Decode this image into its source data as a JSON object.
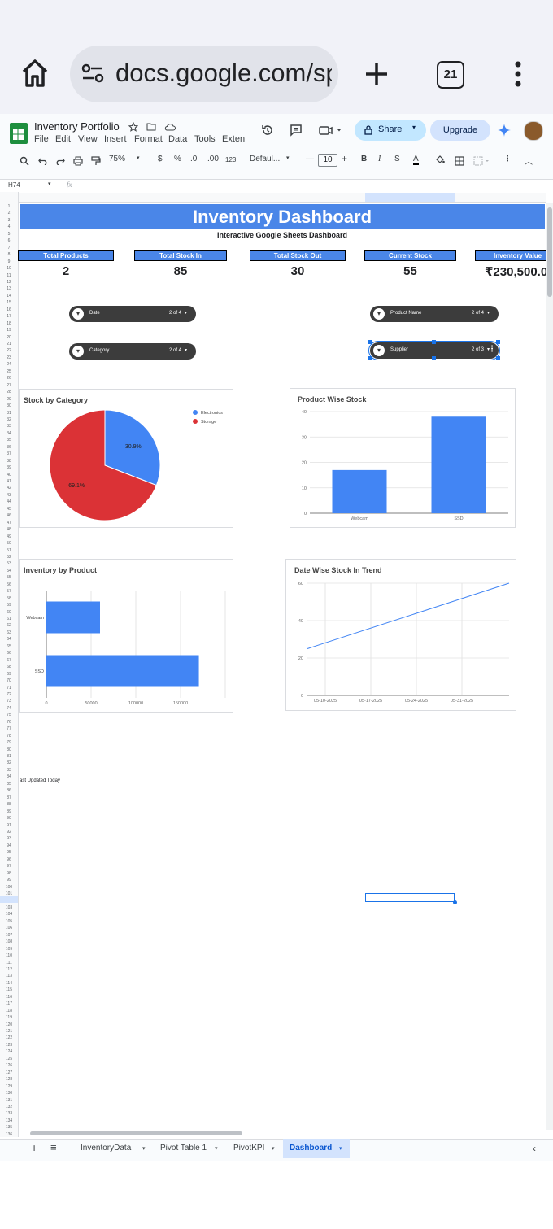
{
  "browser": {
    "url": "docs.google.com/sp",
    "tab_count": "21"
  },
  "app": {
    "title": "Inventory Portfolio",
    "menu": [
      "File",
      "Edit",
      "View",
      "Insert",
      "Format",
      "Data",
      "Tools",
      "Exten"
    ],
    "share_label": "Share",
    "upgrade_label": "Upgrade"
  },
  "toolbar": {
    "zoom": "75%",
    "currency": "$",
    "percent": "%",
    "dec_less": ".0",
    "dec_more": ".00",
    "format_123": "123",
    "font": "Defaul...",
    "font_size": "10"
  },
  "formula_bar": {
    "cell_ref": "H74",
    "fx": "fx"
  },
  "dashboard": {
    "title": "Inventory Dashboard",
    "subtitle": "Interactive Google Sheets Dashboard",
    "kpis": [
      {
        "label": "Total Products",
        "value": "2"
      },
      {
        "label": "Total Stock In",
        "value": "85"
      },
      {
        "label": "Total Stock Out",
        "value": "30"
      },
      {
        "label": "Current Stock",
        "value": "55"
      },
      {
        "label": "Inventory Value",
        "value": "₹230,500.00"
      }
    ],
    "slicers": [
      {
        "label": "Date",
        "count": "2 of 4"
      },
      {
        "label": "Product Name",
        "count": "2 of 4"
      },
      {
        "label": "Category",
        "count": "2 of 4"
      },
      {
        "label": "Supplier",
        "count": "2 of 3"
      }
    ],
    "last_updated": "ast Updated Today"
  },
  "chart_data": [
    {
      "type": "pie",
      "title": "Stock by Category",
      "labels": [
        "Electronics",
        "Storage"
      ],
      "values": [
        30.9,
        69.1
      ],
      "data_labels": [
        "30.9%",
        "69.1%"
      ],
      "colors": [
        "#4285f4",
        "#db3236"
      ],
      "legend": "top-right"
    },
    {
      "type": "bar",
      "title": "Product Wise Stock",
      "categories": [
        "Webcam",
        "SSD"
      ],
      "values": [
        17,
        38
      ],
      "ylim": [
        0,
        40
      ],
      "yticks": [
        "0",
        "10",
        "20",
        "30",
        "40"
      ],
      "color": "#4285f4"
    },
    {
      "type": "bar",
      "orientation": "horizontal",
      "title": "Inventory by Product",
      "categories": [
        "Webcam",
        "SSD"
      ],
      "values": [
        60000,
        170500
      ],
      "xlim": [
        0,
        200000
      ],
      "xticks": [
        "0",
        "50000",
        "100000",
        "150000"
      ],
      "color": "#4285f4"
    },
    {
      "type": "line",
      "title": "Date Wise Stock In Trend",
      "x": [
        "05-10-2025",
        "05-17-2025",
        "05-24-2025",
        "05-31-2025"
      ],
      "y_start": 25,
      "y_end": 60,
      "ylim": [
        0,
        60
      ],
      "yticks": [
        "0",
        "20",
        "40",
        "60"
      ],
      "color": "#4285f4"
    }
  ],
  "sheet_tabs": [
    "InventoryData",
    "Pivot Table 1",
    "PivotKPI",
    "Dashboard"
  ],
  "active_tab": "Dashboard"
}
